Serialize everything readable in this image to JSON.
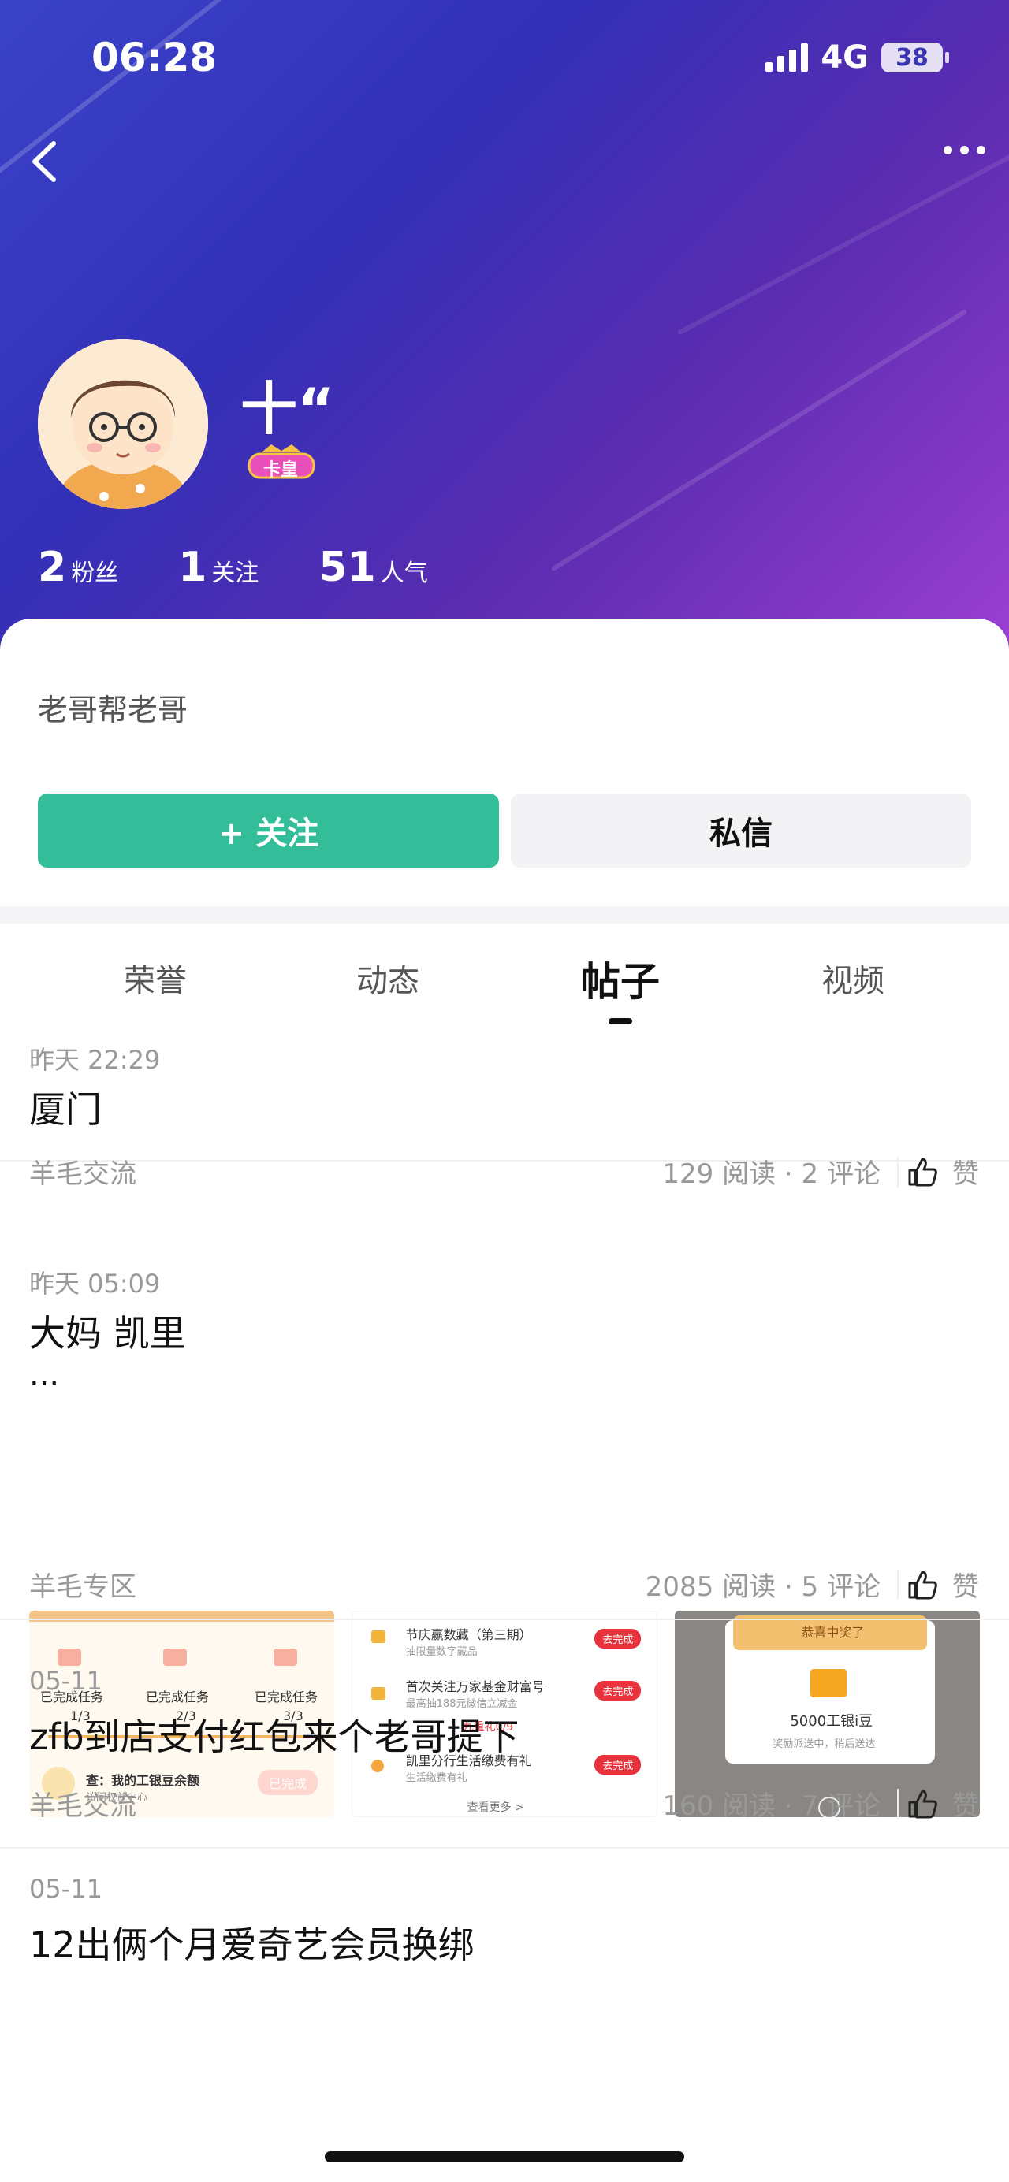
{
  "status_bar": {
    "time": "06:28",
    "network": "4G",
    "battery": "38"
  },
  "profile": {
    "name": "十“",
    "badge_label": "卡皇",
    "stats": [
      {
        "value": "2",
        "label": "粉丝"
      },
      {
        "value": "1",
        "label": "关注"
      },
      {
        "value": "51",
        "label": "人气"
      }
    ],
    "bio": "老哥帮老哥",
    "follow_label": "+ 关注",
    "message_label": "私信"
  },
  "tabs": [
    {
      "label": "荣誉",
      "active": false
    },
    {
      "label": "动态",
      "active": false
    },
    {
      "label": "帖子",
      "active": true
    },
    {
      "label": "视频",
      "active": false
    }
  ],
  "posts": [
    {
      "date": "昨天 22:29",
      "title": "厦门",
      "category": "羊毛交流",
      "info": "129 阅读 · 2 评论",
      "like": "赞"
    },
    {
      "date": "昨天 05:09",
      "title": "大妈  凯里",
      "excerpt": "...",
      "category": "羊毛专区",
      "info": "2085 阅读 · 5 评论",
      "like": "赞",
      "thumb1": {
        "tasks": [
          "已完成任务",
          "已完成任务",
          "已完成任务"
        ],
        "progress": [
          "1/3",
          "2/3",
          "3/3"
        ],
        "query": "查：我的工银豆余额",
        "query_sub": "访问权益中心",
        "btn": "已完成"
      },
      "thumb2": {
        "rows": [
          {
            "title": "节庆赢数藏（第三期）",
            "sub": "抽限量数字藏品",
            "btn": "去完成"
          },
          {
            "title": "首次关注万家基金财富号",
            "sub": "最高抽188元微信立减金",
            "btn": "去完成"
          },
          {
            "title": "凯里分行生活缴费有礼",
            "sub": "生活缴费有礼",
            "btn": "去完成"
          }
        ],
        "gift": "九重礼0/9",
        "more": "查看更多 >"
      },
      "thumb3": {
        "ribbon": "恭喜中奖了",
        "prize": "5000工银i豆",
        "note": "奖励派送中，稍后送达"
      }
    },
    {
      "date": "05-11",
      "title": "zfb到店支付红包来个老哥提下",
      "category": "羊毛交流",
      "info": "160 阅读 · 7 评论",
      "like": "赞"
    },
    {
      "date": "05-11",
      "title": "12出俩个月爱奇艺会员换绑"
    }
  ]
}
